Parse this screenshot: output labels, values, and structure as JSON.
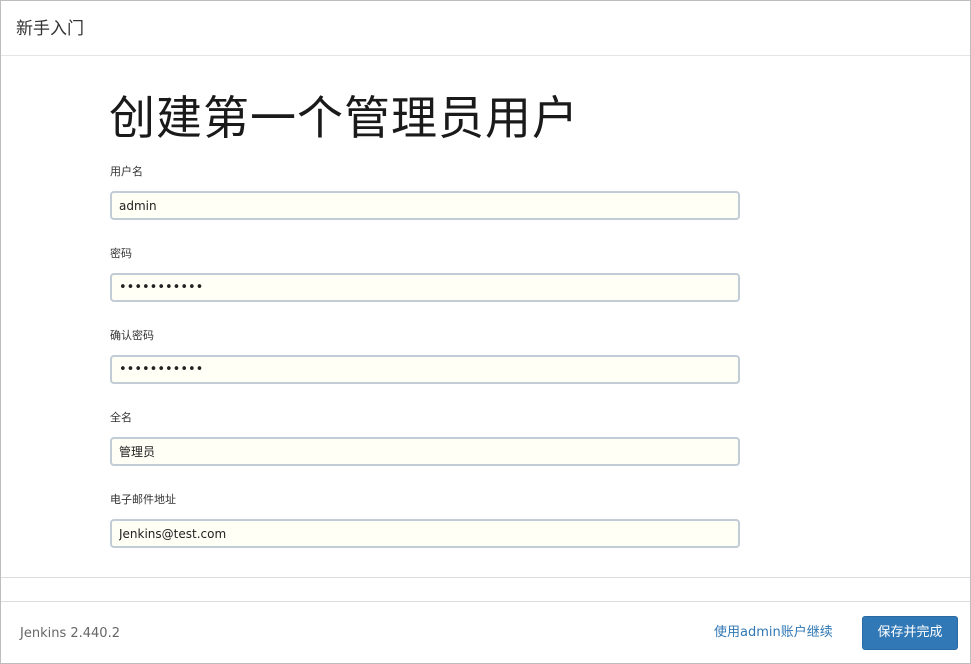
{
  "header": {
    "title": "新手入门"
  },
  "main": {
    "title": "创建第一个管理员用户",
    "fields": [
      {
        "label": "用户名",
        "value": "admin"
      },
      {
        "label": "密码",
        "value": "•••••••••••"
      },
      {
        "label": "确认密码",
        "value": "•••••••••••"
      },
      {
        "label": "全名",
        "value": "管理员"
      },
      {
        "label": "电子邮件地址",
        "value": "Jenkins@test.com"
      }
    ]
  },
  "footer": {
    "version": "Jenkins 2.440.2",
    "skip_label": "使用admin账户继续",
    "save_label": "保存并完成"
  },
  "colors": {
    "primary": "#3178b6",
    "link": "#2f77b4",
    "input_border": "#c1ccd6"
  }
}
